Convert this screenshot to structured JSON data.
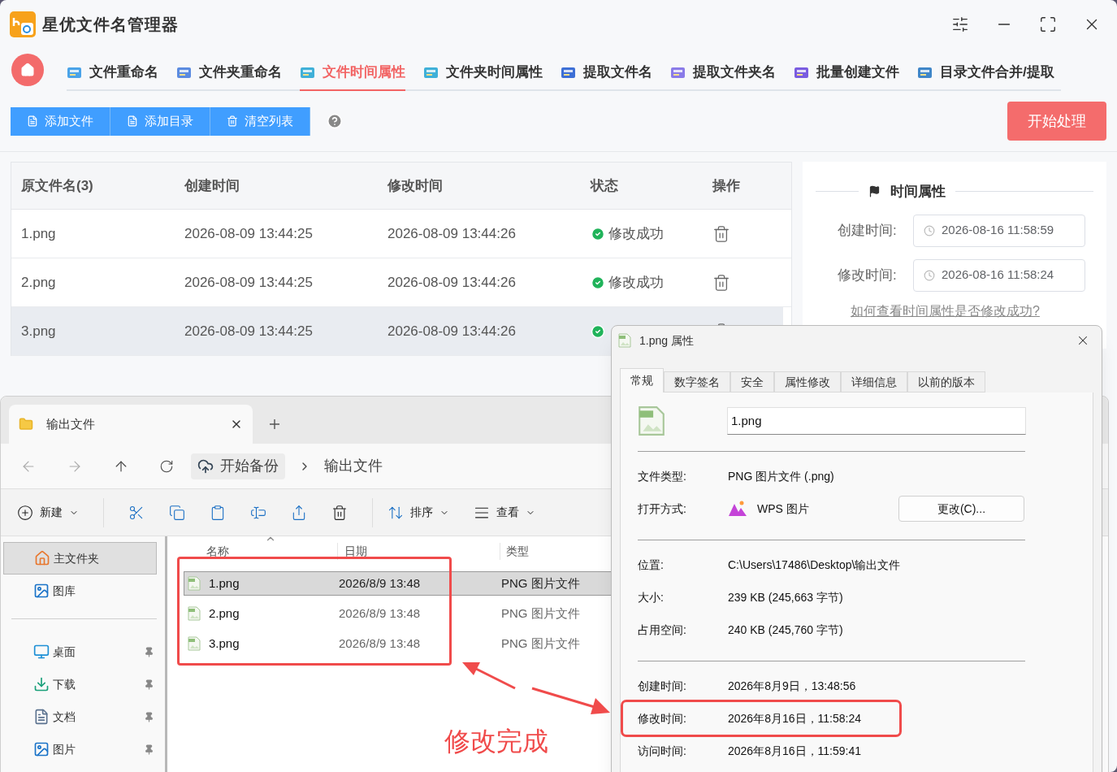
{
  "app": {
    "title": "星优文件名管理器",
    "tabs": [
      {
        "label": "文件重命名",
        "selected": false,
        "color": "#4aa3e8"
      },
      {
        "label": "文件夹重命名",
        "selected": false,
        "color": "#5b8be0"
      },
      {
        "label": "文件时间属性",
        "selected": true,
        "color": "#3fb0d8"
      },
      {
        "label": "文件夹时间属性",
        "selected": false,
        "color": "#3fb0d8"
      },
      {
        "label": "提取文件名",
        "selected": false,
        "color": "#3d6fd6"
      },
      {
        "label": "提取文件夹名",
        "selected": false,
        "color": "#8a7be8"
      },
      {
        "label": "批量创建文件",
        "selected": false,
        "color": "#7a5ce0"
      },
      {
        "label": "目录文件合并/提取",
        "selected": false,
        "color": "#3f86c8"
      }
    ],
    "toolbar": [
      {
        "kind": "file",
        "label": "添加文件"
      },
      {
        "kind": "file",
        "label": "添加目录"
      },
      {
        "kind": "trash",
        "label": "清空列表"
      }
    ],
    "start_button": "开始处理",
    "table": {
      "columns": [
        "原文件名(3)",
        "创建时间",
        "修改时间",
        "状态",
        "操作"
      ],
      "rows": [
        {
          "name": "1.png",
          "created": "2026-08-09 13:44:25",
          "modified": "2026-08-09 13:44:26",
          "status": "修改成功",
          "selected": false
        },
        {
          "name": "2.png",
          "created": "2026-08-09 13:44:25",
          "modified": "2026-08-09 13:44:26",
          "status": "修改成功",
          "selected": false
        },
        {
          "name": "3.png",
          "created": "2026-08-09 13:44:25",
          "modified": "2026-08-09 13:44:26",
          "selected": true
        }
      ]
    },
    "time_panel": {
      "title": "时间属性",
      "fields": [
        {
          "label": "创建时间:",
          "value": "2026-08-16 11:58:59"
        },
        {
          "label": "修改时间:",
          "value": "2026-08-16 11:58:24"
        }
      ],
      "link": "如何查看时间属性是否修改成功?"
    }
  },
  "explorer": {
    "tab_title": "输出文件",
    "breadcrumb": [
      "开始备份",
      "输出文件"
    ],
    "commands": [
      {
        "label": "新建"
      },
      {
        "label": "排序"
      },
      {
        "label": "查看"
      }
    ],
    "sidebar": [
      {
        "label": "主文件夹",
        "selected": true,
        "pinned": false,
        "kind": "home"
      },
      {
        "label": "图库",
        "selected": false,
        "pinned": false,
        "kind": "gallery"
      },
      {
        "label": "桌面",
        "selected": false,
        "pinned": true,
        "kind": "desktop"
      },
      {
        "label": "下载",
        "selected": false,
        "pinned": true,
        "kind": "download"
      },
      {
        "label": "文档",
        "selected": false,
        "pinned": true,
        "kind": "document"
      },
      {
        "label": "图片",
        "selected": false,
        "pinned": true,
        "kind": "gallery"
      }
    ],
    "columns": [
      "名称",
      "日期",
      "类型"
    ],
    "files": [
      {
        "name": "1.png",
        "date": "2026/8/9 13:48",
        "type": "PNG 图片文件",
        "selected": true
      },
      {
        "name": "2.png",
        "date": "2026/8/9 13:48",
        "type": "PNG 图片文件",
        "selected": false
      },
      {
        "name": "3.png",
        "date": "2026/8/9 13:48",
        "type": "PNG 图片文件",
        "selected": false
      }
    ]
  },
  "dialog": {
    "title": "1.png 属性",
    "tabs": [
      {
        "label": "常规",
        "selected": true
      },
      {
        "label": "数字签名",
        "selected": false
      },
      {
        "label": "安全",
        "selected": false
      },
      {
        "label": "属性修改",
        "selected": false
      },
      {
        "label": "详细信息",
        "selected": false
      },
      {
        "label": "以前的版本",
        "selected": false
      }
    ],
    "filename": "1.png",
    "sections": [
      [
        {
          "label": "文件类型:",
          "value": "PNG 图片文件 (.png)",
          "highlighted": false
        },
        {
          "label": "打开方式:",
          "value": "WPS 图片",
          "kind": "app",
          "button": "更改(C)...",
          "highlighted": false
        }
      ],
      [
        {
          "label": "位置:",
          "value": "C:\\Users\\17486\\Desktop\\输出文件",
          "highlighted": false
        },
        {
          "label": "大小:",
          "value": "239 KB (245,663 字节)",
          "highlighted": false
        },
        {
          "label": "占用空间:",
          "value": "240 KB (245,760 字节)",
          "highlighted": false
        }
      ],
      [
        {
          "label": "创建时间:",
          "value": "2026年8月9日，13:48:56",
          "highlighted": false
        },
        {
          "label": "修改时间:",
          "value": "2026年8月16日，11:58:24",
          "highlighted": true
        },
        {
          "label": "访问时间:",
          "value": "2026年8月16日，11:59:41",
          "highlighted": false
        }
      ]
    ]
  },
  "annotation": {
    "text": "修改完成"
  }
}
